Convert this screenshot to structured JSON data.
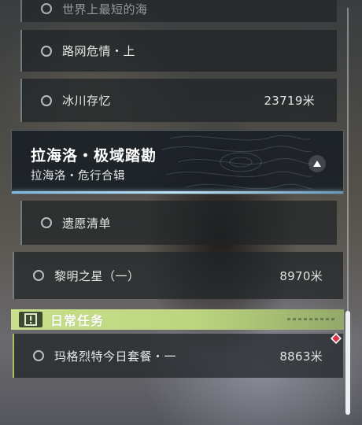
{
  "quest_list": {
    "partial_top_label": "世界上最短的海",
    "rows": [
      {
        "label": "路网危情・上",
        "distance": ""
      },
      {
        "label": "冰川存忆",
        "distance": "23719米"
      }
    ],
    "expanded_chapter": {
      "title": "拉海洛・极域踏勘",
      "subtitle": "拉海洛・危行合辑"
    },
    "chapter_rows": [
      {
        "label": "遗愿清单",
        "distance": ""
      },
      {
        "label": "黎明之星（一）",
        "distance": "8970米"
      }
    ]
  },
  "daily": {
    "header_label": "日常任务",
    "accent_color": "#c8e08a",
    "rows": [
      {
        "label": "玛格烈特今日套餐・一",
        "distance": "8863米"
      }
    ]
  },
  "icons": {
    "status": "circle-outline-icon",
    "collapse": "triangle-up-icon",
    "warning": "exclamation-box-icon",
    "tracked": "red-diamond-icon"
  }
}
